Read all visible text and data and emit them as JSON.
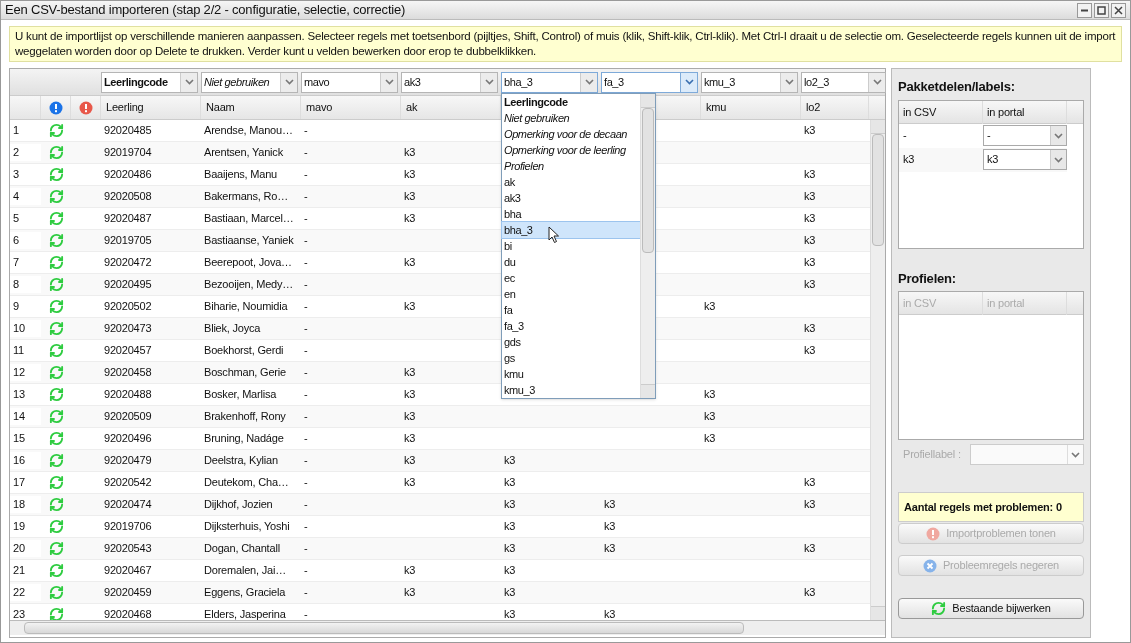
{
  "window": {
    "title": "Een CSV-bestand importeren (stap 2/2 - configuratie, selectie, correctie)"
  },
  "info": "U kunt de importlijst op verschillende manieren aanpassen. Selecteer regels met toetsenbord (pijltjes, Shift, Control) of muis (klik, Shift-klik, Ctrl-klik). Met Ctrl-I draait u de selectie om. Geselecteerde regels kunnen uit de import weggelaten worden door op Delete te drukken. Verder kunt u velden bewerken door erop te dubbelklikken.",
  "selectors": [
    {
      "value": "Leerlingcode",
      "kind": "key",
      "open": false,
      "hover": false
    },
    {
      "value": "Niet gebruiken",
      "kind": "special",
      "open": false,
      "hover": false
    },
    {
      "value": "mavo",
      "kind": "column",
      "open": false,
      "hover": false
    },
    {
      "value": "ak3",
      "kind": "column",
      "open": false,
      "hover": false
    },
    {
      "value": "bha_3",
      "kind": "column",
      "open": true,
      "hover": false
    },
    {
      "value": "fa_3",
      "kind": "column",
      "open": false,
      "hover": true
    },
    {
      "value": "kmu_3",
      "kind": "column",
      "open": false,
      "hover": false
    },
    {
      "value": "lo2_3",
      "kind": "column",
      "open": false,
      "hover": false
    }
  ],
  "columns": [
    "Leerling",
    "Naam",
    "mavo",
    "ak",
    null,
    null,
    "kmu",
    "lo2"
  ],
  "dropdown": [
    {
      "label": "Leerlingcode",
      "kind": "key",
      "selected": false
    },
    {
      "label": "Niet gebruiken",
      "kind": "special",
      "selected": false
    },
    {
      "label": "Opmerking voor de decaan",
      "kind": "special",
      "selected": false
    },
    {
      "label": "Opmerking voor de leerling",
      "kind": "special",
      "selected": false
    },
    {
      "label": "Profielen",
      "kind": "special",
      "selected": false
    },
    {
      "label": "ak",
      "kind": "column",
      "selected": false
    },
    {
      "label": "ak3",
      "kind": "column",
      "selected": false
    },
    {
      "label": "bha",
      "kind": "column",
      "selected": false
    },
    {
      "label": "bha_3",
      "kind": "column",
      "selected": true
    },
    {
      "label": "bi",
      "kind": "column",
      "selected": false
    },
    {
      "label": "du",
      "kind": "column",
      "selected": false
    },
    {
      "label": "ec",
      "kind": "column",
      "selected": false
    },
    {
      "label": "en",
      "kind": "column",
      "selected": false
    },
    {
      "label": "fa",
      "kind": "column",
      "selected": false
    },
    {
      "label": "fa_3",
      "kind": "column",
      "selected": false
    },
    {
      "label": "gds",
      "kind": "column",
      "selected": false
    },
    {
      "label": "gs",
      "kind": "column",
      "selected": false
    },
    {
      "label": "kmu",
      "kind": "column",
      "selected": false
    },
    {
      "label": "kmu_3",
      "kind": "column",
      "selected": false
    }
  ],
  "rows": [
    {
      "n": "1",
      "cells": [
        "92020485",
        "Arendse, Manou…",
        "-",
        null,
        null,
        null,
        null,
        "k3"
      ]
    },
    {
      "n": "2",
      "cells": [
        "92019704",
        "Arentsen, Yanick",
        "-",
        "k3",
        null,
        null,
        null,
        null
      ]
    },
    {
      "n": "3",
      "cells": [
        "92020486",
        "Baaijens, Manu",
        "-",
        "k3",
        null,
        null,
        null,
        "k3"
      ]
    },
    {
      "n": "4",
      "cells": [
        "92020508",
        "Bakermans, Ro…",
        "-",
        "k3",
        null,
        null,
        null,
        "k3"
      ]
    },
    {
      "n": "5",
      "cells": [
        "92020487",
        "Bastiaan, Marcel…",
        "-",
        "k3",
        null,
        null,
        null,
        "k3"
      ]
    },
    {
      "n": "6",
      "cells": [
        "92019705",
        "Bastiaanse, Yaniek",
        "-",
        null,
        null,
        null,
        null,
        "k3"
      ]
    },
    {
      "n": "7",
      "cells": [
        "92020472",
        "Beerepoot, Jova…",
        "-",
        "k3",
        null,
        null,
        null,
        "k3"
      ]
    },
    {
      "n": "8",
      "cells": [
        "92020495",
        "Bezooijen, Medy…",
        "-",
        null,
        null,
        null,
        null,
        "k3"
      ]
    },
    {
      "n": "9",
      "cells": [
        "92020502",
        "Biharie, Noumidia",
        "-",
        "k3",
        null,
        null,
        "k3",
        null
      ]
    },
    {
      "n": "10",
      "cells": [
        "92020473",
        "Bliek, Joyca",
        "-",
        null,
        null,
        null,
        null,
        "k3"
      ]
    },
    {
      "n": "11",
      "cells": [
        "92020457",
        "Boekhorst, Gerdi",
        "-",
        null,
        null,
        null,
        null,
        "k3"
      ]
    },
    {
      "n": "12",
      "cells": [
        "92020458",
        "Boschman, Gerie",
        "-",
        "k3",
        null,
        null,
        null,
        null
      ]
    },
    {
      "n": "13",
      "cells": [
        "92020488",
        "Bosker, Marlisa",
        "-",
        "k3",
        null,
        null,
        "k3",
        null
      ]
    },
    {
      "n": "14",
      "cells": [
        "92020509",
        "Brakenhoff, Rony",
        "-",
        "k3",
        null,
        null,
        "k3",
        null
      ]
    },
    {
      "n": "15",
      "cells": [
        "92020496",
        "Bruning, Nadáge",
        "-",
        "k3",
        null,
        null,
        "k3",
        null
      ]
    },
    {
      "n": "16",
      "cells": [
        "92020479",
        "Deelstra, Kylian",
        "-",
        "k3",
        "k3",
        null,
        null,
        null
      ]
    },
    {
      "n": "17",
      "cells": [
        "92020542",
        "Deutekom, Cha…",
        "-",
        "k3",
        "k3",
        null,
        null,
        "k3"
      ]
    },
    {
      "n": "18",
      "cells": [
        "92020474",
        "Dijkhof, Jozien",
        "-",
        null,
        "k3",
        "k3",
        null,
        "k3"
      ]
    },
    {
      "n": "19",
      "cells": [
        "92019706",
        "Dijksterhuis, Yoshi",
        "-",
        null,
        "k3",
        "k3",
        null,
        null
      ]
    },
    {
      "n": "20",
      "cells": [
        "92020543",
        "Dogan, Chantall",
        "-",
        null,
        "k3",
        "k3",
        null,
        "k3"
      ]
    },
    {
      "n": "21",
      "cells": [
        "92020467",
        "Doremalen, Jai…",
        "-",
        "k3",
        "k3",
        null,
        null,
        null
      ]
    },
    {
      "n": "22",
      "cells": [
        "92020459",
        "Eggens, Graciela",
        "-",
        "k3",
        "k3",
        null,
        null,
        "k3"
      ]
    },
    {
      "n": "23",
      "cells": [
        "92020468",
        "Elders, Jasperina",
        "-",
        null,
        "k3",
        "k3",
        null,
        null
      ]
    }
  ],
  "side": {
    "labels_title": "Pakketdelen/labels:",
    "labels_headers": [
      "in CSV",
      "in portal"
    ],
    "labels_rows": [
      {
        "csv": "-",
        "portal": "-"
      },
      {
        "csv": "k3",
        "portal": "k3"
      }
    ],
    "profiles_title": "Profielen:",
    "profiles_headers": [
      "in CSV",
      "in portal"
    ],
    "profiles_disabled": true,
    "profile_label": {
      "label": "Profiellabel :",
      "disabled": true
    },
    "problems": "Aantal regels met problemen: 0",
    "buttons": [
      {
        "label": "Importproblemen tonen",
        "kind": "error",
        "disabled": true
      },
      {
        "label": "Probleemregels negeren",
        "kind": "ignore",
        "disabled": true
      },
      {
        "label": "Bestaande bijwerken",
        "kind": "update",
        "disabled": false
      }
    ]
  }
}
